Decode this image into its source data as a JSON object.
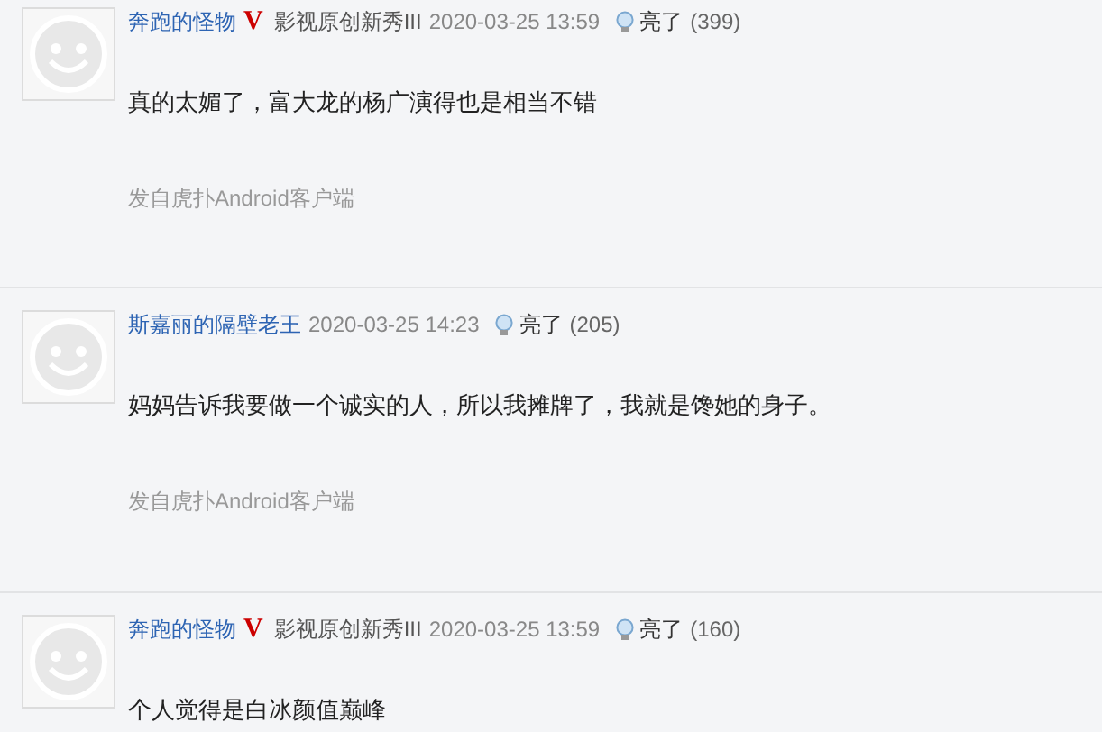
{
  "posts": [
    {
      "username": "奔跑的怪物",
      "badge": "V",
      "title": "影视原创新秀III",
      "time": "2020-03-25 13:59",
      "light_label": "亮了",
      "light_count": "(399)",
      "content": "真的太媚了，富大龙的杨广演得也是相当不错",
      "source": "发自虎扑Android客户端"
    },
    {
      "username": "斯嘉丽的隔壁老王",
      "time": "2020-03-25 14:23",
      "light_label": "亮了",
      "light_count": "(205)",
      "content": "妈妈告诉我要做一个诚实的人，所以我摊牌了，我就是馋她的身子。",
      "source": "发自虎扑Android客户端"
    },
    {
      "username": "奔跑的怪物",
      "badge": "V",
      "title": "影视原创新秀III",
      "time": "2020-03-25 13:59",
      "light_label": "亮了",
      "light_count": "(160)",
      "content": "个人觉得是白冰颜值巅峰"
    }
  ]
}
